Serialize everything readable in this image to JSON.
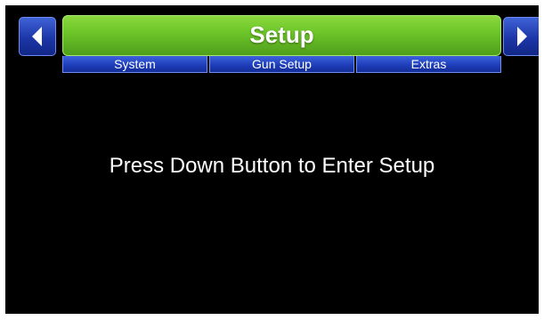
{
  "header": {
    "title": "Setup",
    "left_nav_icon": "arrow-left-icon",
    "right_nav_icon": "arrow-right-icon"
  },
  "tabs": [
    {
      "label": "System"
    },
    {
      "label": "Gun Setup"
    },
    {
      "label": "Extras"
    }
  ],
  "main": {
    "message": "Press Down Button to Enter Setup"
  },
  "colors": {
    "screen_background": "#000000",
    "title_bar_green": "#6ec72a",
    "button_blue": "#1d3cb8",
    "text": "#ffffff"
  }
}
